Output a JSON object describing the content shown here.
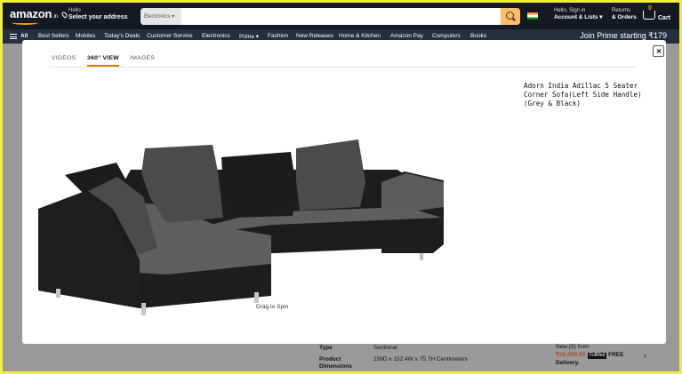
{
  "header": {
    "logo": "amazon",
    "logo_suffix": ".in",
    "address_greeting": "Hello",
    "address_action": "Select your address",
    "search_category": "Electronics",
    "account_greeting": "Hello, Sign in",
    "account_label": "Account & Lists",
    "returns_label": "Returns",
    "orders_label": "& Orders",
    "cart_count": "0",
    "cart_label": "Cart"
  },
  "subnav": {
    "all_label": "All",
    "items": [
      "Best Sellers",
      "Mobiles",
      "Today's Deals",
      "Customer Service",
      "Electronics",
      "Prime",
      "Fashion",
      "New Releases",
      "Home & Kitchen",
      "Amazon Pay",
      "Computers",
      "Books"
    ],
    "promo": "Join Prime starting ₹179"
  },
  "modal": {
    "tabs": [
      "VIDEOS",
      "360° VIEW",
      "IMAGES"
    ],
    "active_tab": "360° VIEW",
    "product_title": "Adorn India Adillac 5 Seater Corner Sofa(Left Side Handle)(Grey & Black)",
    "spin_hint": "Drag to Spin",
    "close_label": "×"
  },
  "specs": [
    {
      "label": "Type",
      "value": "Sectional"
    },
    {
      "label": "Product Dimensions",
      "value": "259D x 152.4W x 75.7H Centimeters"
    }
  ],
  "buybox": {
    "new_from": "New (5) from",
    "price": "₹26,999.00",
    "fulfilled": "Fulfilled",
    "free": "FREE",
    "delivery": "Delivery."
  },
  "colors": {
    "nav_dark": "#131921",
    "nav_sub": "#232f3e",
    "accent": "#e77600",
    "search_button": "#febd69",
    "sofa_black": "#1c1c1e",
    "sofa_grey": "#5b5a5c"
  }
}
